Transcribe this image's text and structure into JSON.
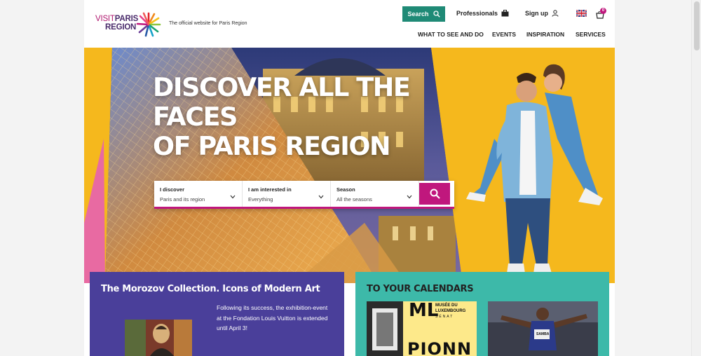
{
  "logo": {
    "visit": "VISIT",
    "paris": "PARIS",
    "region": "REGION",
    "tagline": "The official website for Paris Region"
  },
  "header": {
    "search_label": "Search",
    "professionals_label": "Professionals",
    "signup_label": "Sign up",
    "cart_count": "0",
    "language": "en-GB"
  },
  "nav": {
    "items": [
      "WHAT TO SEE AND DO",
      "EVENTS",
      "INSPIRATION",
      "SERVICES"
    ]
  },
  "hero": {
    "title_line1": "DISCOVER ALL THE FACES",
    "title_line2": "OF PARIS REGION"
  },
  "search": {
    "fields": [
      {
        "label": "I discover",
        "value": "Paris and its region"
      },
      {
        "label": "I am interested in",
        "value": "Everything"
      },
      {
        "label": "Season",
        "value": "All the seasons"
      }
    ]
  },
  "feature": {
    "title": "The Morozov Collection. Icons of Modern Art",
    "description": "Following its success, the exhibition-event at the Fondation Louis Vuitton is extended until April 3!"
  },
  "calendars": {
    "title": "TO YOUR CALENDARS",
    "thumb1_text_big": "ML",
    "thumb1_text_small1": "MUSÉE DU",
    "thumb1_text_small2": "LUXEMBOURG",
    "thumb1_text_small3": "SÉNAT",
    "thumb1_text_bottom": "PIONN",
    "thumb2_bib": "SAMBA"
  },
  "colors": {
    "brand_magenta": "#c0177d",
    "brand_teal": "#1f8a76",
    "hero_yellow": "#f5b81d",
    "card_purple": "#4a3f9a",
    "card_teal": "#3db9a9"
  }
}
